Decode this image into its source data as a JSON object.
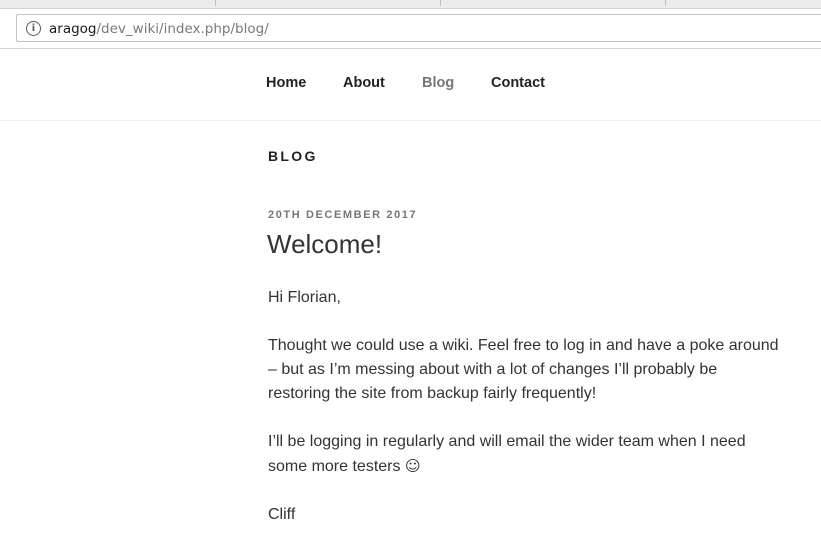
{
  "browser": {
    "url_host": "aragog",
    "url_path": "/dev_wiki/index.php/blog/",
    "info_icon": "info-icon"
  },
  "nav": {
    "items": [
      {
        "label": "Home"
      },
      {
        "label": "About"
      },
      {
        "label": "Blog",
        "current": true
      },
      {
        "label": "Contact"
      }
    ]
  },
  "page": {
    "title": "BLOG"
  },
  "post": {
    "date": "20TH DECEMBER 2017",
    "title": "Welcome!",
    "paragraphs": [
      {
        "lines": [
          "Hi Florian,"
        ]
      },
      {
        "lines": [
          "Thought we could use a wiki.  Feel free to log in and have a poke around",
          "– but as I’m messing about with a lot of changes I’ll probably be",
          "restoring the site from backup fairly frequently!"
        ]
      },
      {
        "lines": [
          "I’ll be logging in regularly and will email the wider team when I need",
          "some more testers"
        ],
        "trailing_glyph": "☺"
      },
      {
        "lines": [
          "Cliff"
        ]
      }
    ]
  },
  "colors": {
    "text": "#333333",
    "nav_text": "#222222",
    "nav_current": "#767676",
    "date": "#767676"
  }
}
